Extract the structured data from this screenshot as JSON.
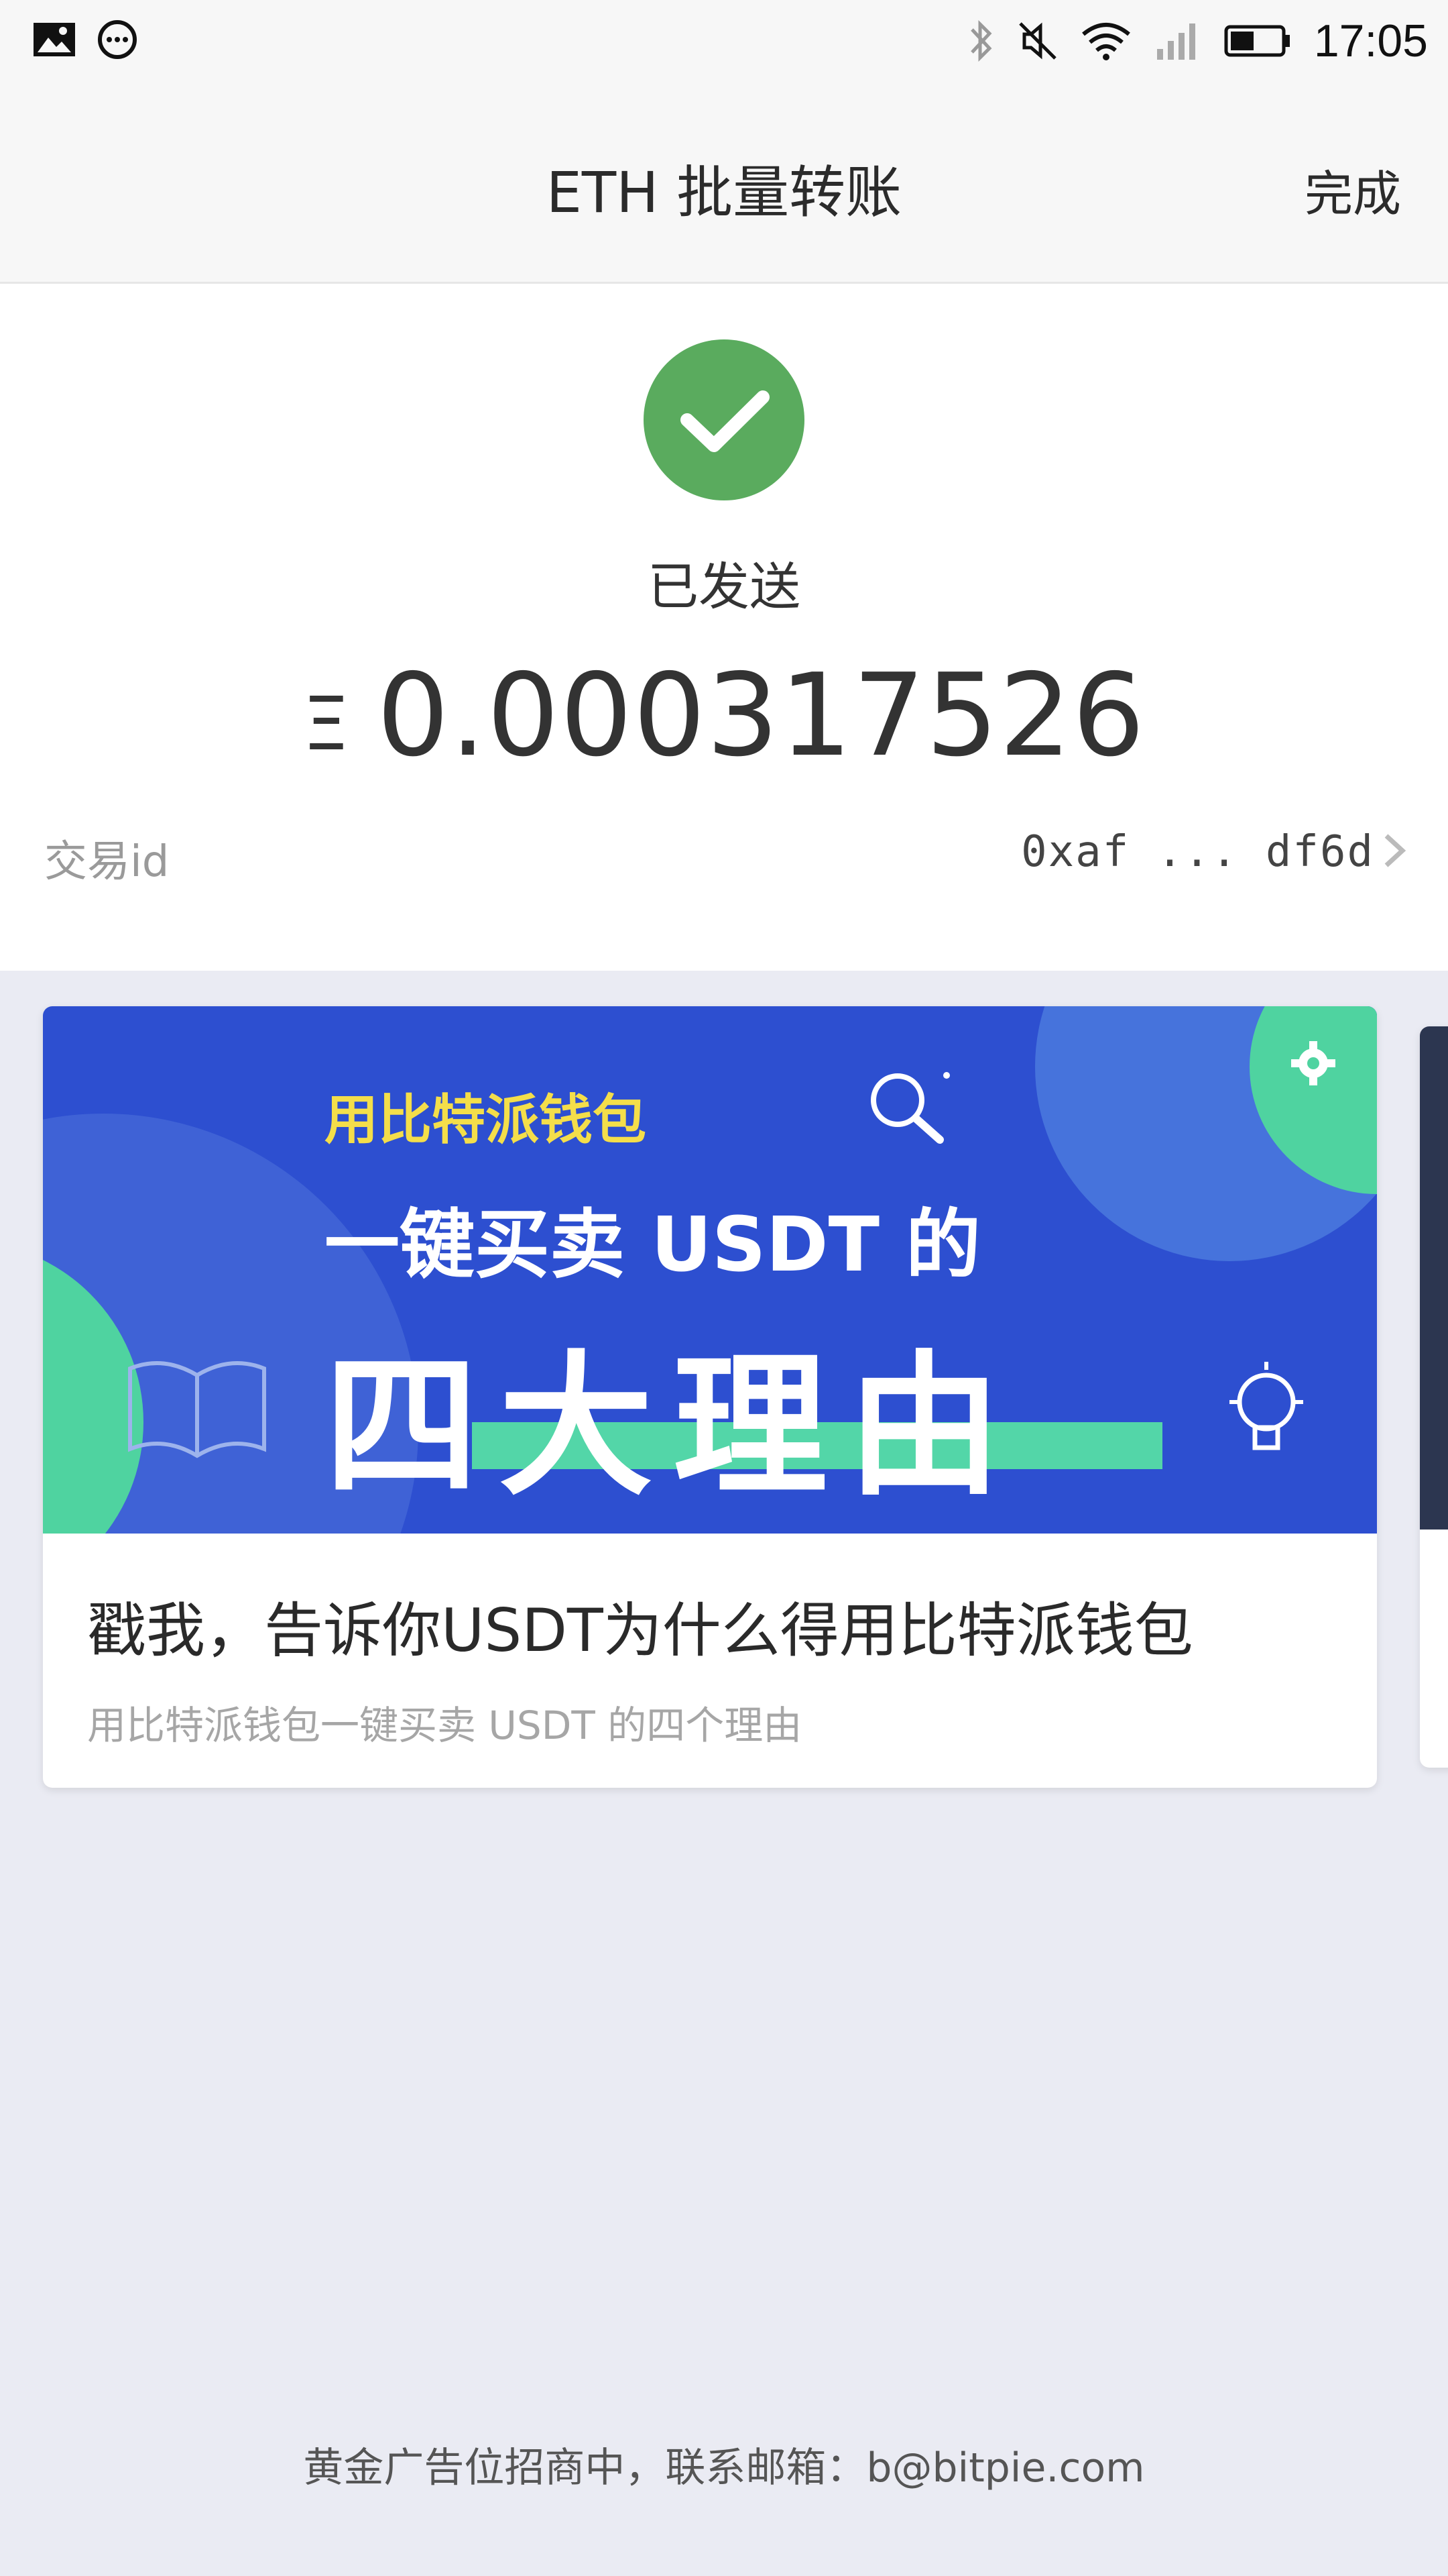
{
  "status_bar": {
    "time": "17:05",
    "left_icons": [
      "image-icon",
      "message-icon"
    ],
    "right_icons": [
      "bluetooth-icon",
      "mute-icon",
      "wifi-icon",
      "signal-icon",
      "battery-icon"
    ]
  },
  "nav": {
    "title": "ETH 批量转账",
    "done_label": "完成"
  },
  "summary": {
    "status": "已发送",
    "currency_symbol": "Ξ",
    "amount": "0.000317526",
    "txid_label": "交易id",
    "txid_value": "0xaf ... df6d"
  },
  "ad": {
    "banner_line1": "用比特派钱包",
    "banner_line2": "一键买卖 USDT 的",
    "banner_line3": "四大理由",
    "title": "戳我，告诉你USDT为什么得用比特派钱包",
    "subtitle": "用比特派钱包一键买卖 USDT 的四个理由"
  },
  "footer": {
    "text": "黄金广告位招商中，联系邮箱：b@bitpie.com"
  },
  "colors": {
    "success_green": "#5aab5e",
    "banner_blue": "#2d4fd0",
    "banner_yellow": "#f4de4a",
    "banner_mint": "#53d6a8",
    "background": "#eaebf3"
  }
}
